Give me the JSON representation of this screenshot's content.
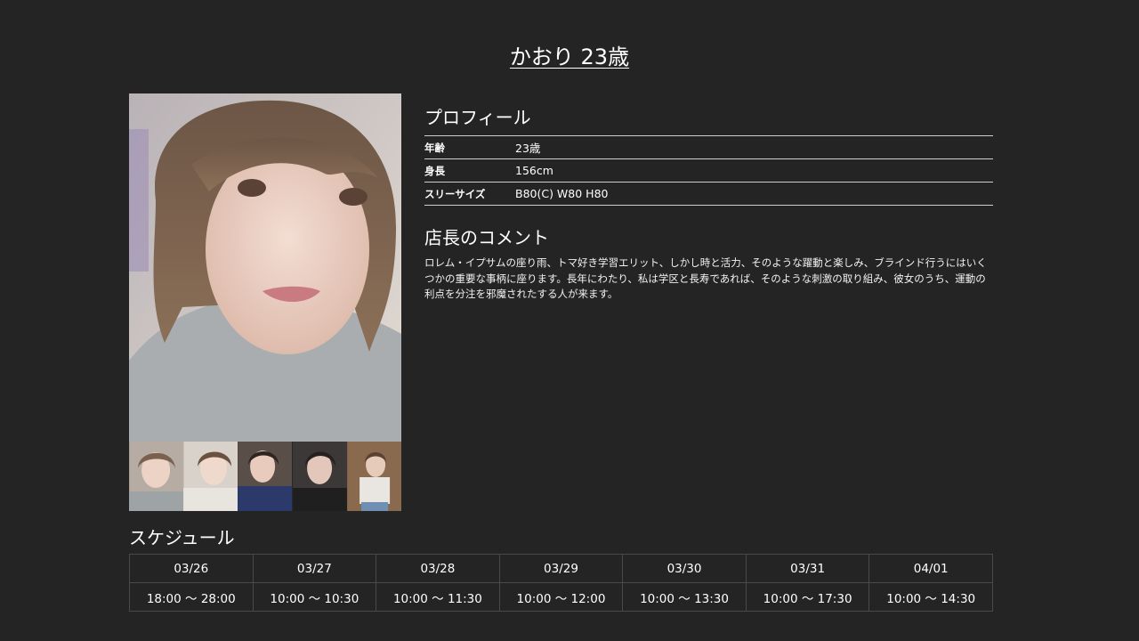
{
  "cast": {
    "name_age": "かおり 23歳"
  },
  "profile": {
    "heading": "プロフィール",
    "rows": [
      {
        "key": "年齢",
        "value": "23歳"
      },
      {
        "key": "身長",
        "value": "156cm"
      },
      {
        "key": "スリーサイズ",
        "value": "B80(C) W80 H80"
      }
    ]
  },
  "comment": {
    "heading": "店長のコメント",
    "text": "ロレム・イプサムの座り雨、トマ好き学習エリット、しかし時と活力、そのような躍動と楽しみ、ブラインド行うにはいくつかの重要な事柄に座ります。長年にわたり、私は学区と長寿であれば、そのような刺激の取り組み、彼女のうち、運動の利点を分注を邪魔されたする人が来ます。"
  },
  "schedule": {
    "heading": "スケジュール",
    "days": [
      {
        "date": "03/26",
        "time": "18:00 〜 28:00"
      },
      {
        "date": "03/27",
        "time": "10:00 〜 10:30"
      },
      {
        "date": "03/28",
        "time": "10:00 〜 11:30"
      },
      {
        "date": "03/29",
        "time": "10:00 〜 12:00"
      },
      {
        "date": "03/30",
        "time": "10:00 〜 13:30"
      },
      {
        "date": "03/31",
        "time": "10:00 〜 17:30"
      },
      {
        "date": "04/01",
        "time": "10:00 〜 14:30"
      }
    ]
  },
  "colors": {
    "background": "#242424",
    "text": "#ffffff",
    "rule": "#cfcfcf",
    "table_border": "#4a4a4a"
  }
}
